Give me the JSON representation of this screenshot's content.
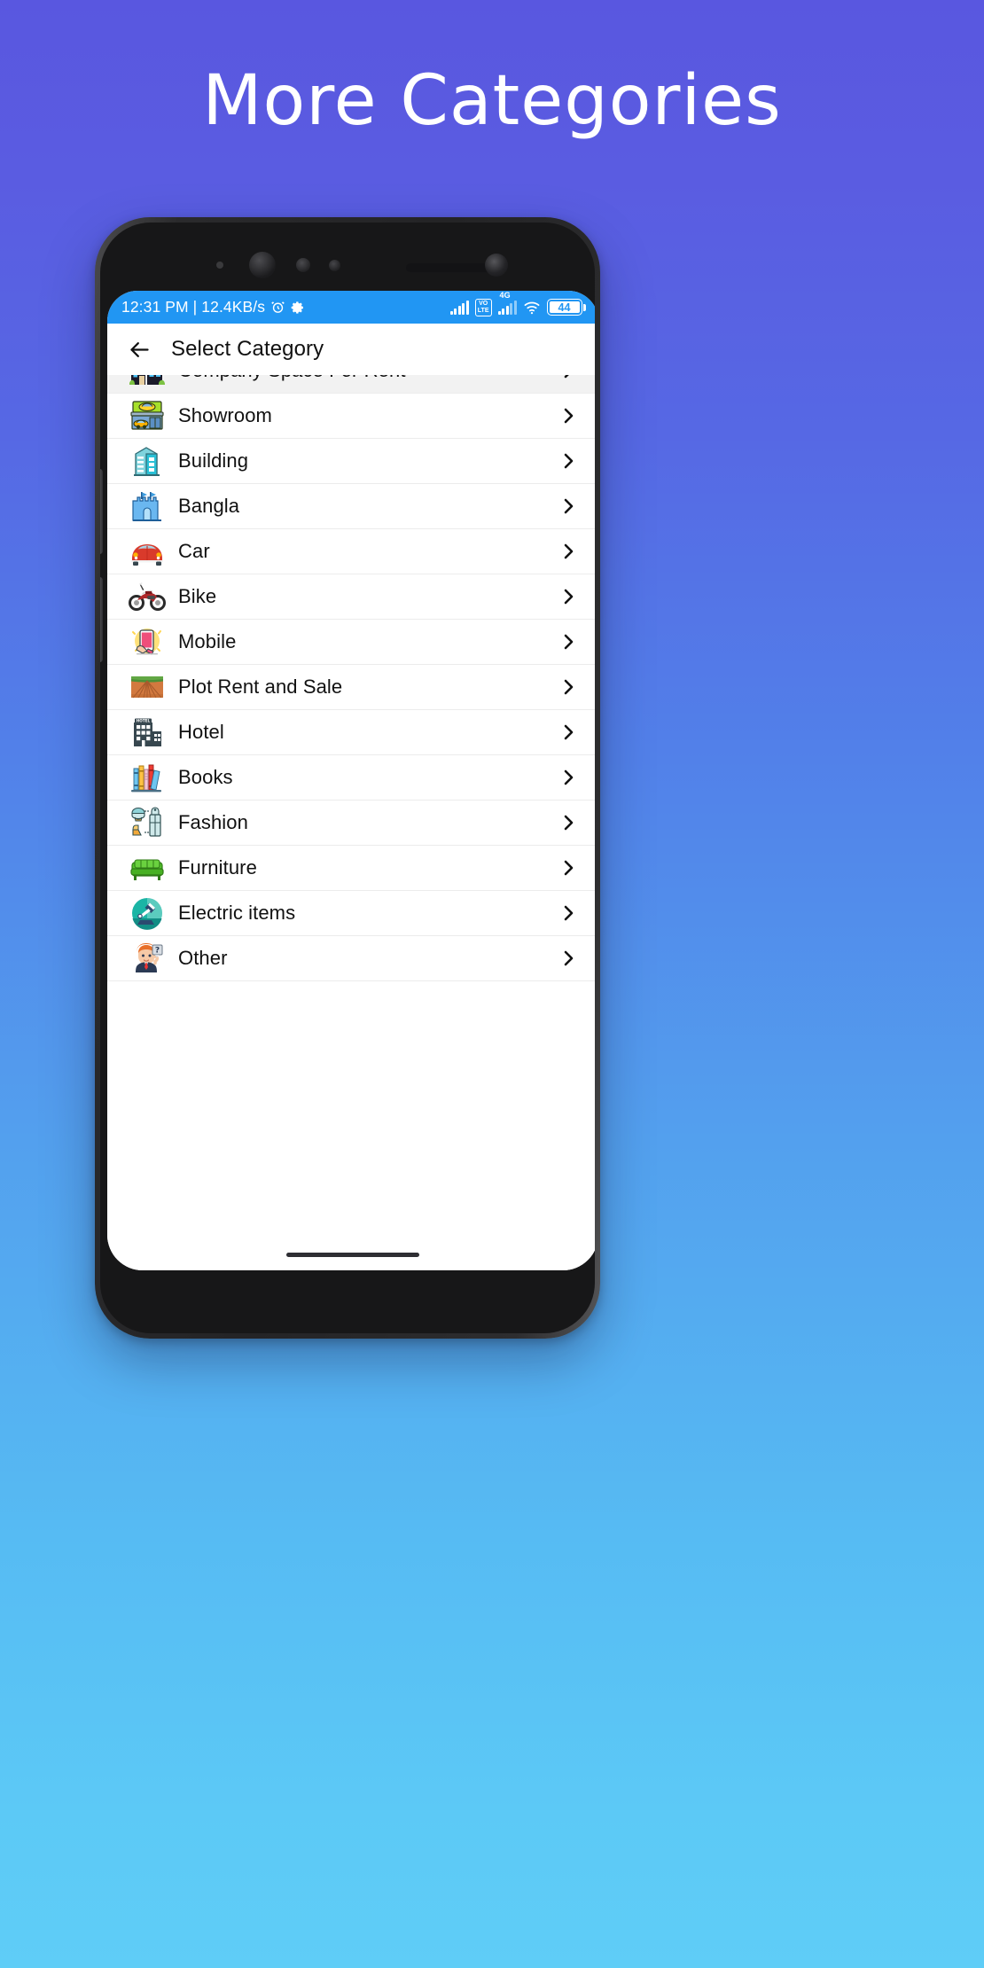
{
  "page": {
    "title": "More Categories",
    "background_top_color": "#5957e0",
    "background_bottom_color": "#5fcdf7"
  },
  "statusbar": {
    "time_and_speed": "12:31 PM | 12.4KB/s",
    "alarm_icon": "alarm-clock-icon",
    "settings_icon": "gear-icon",
    "signal_icon": "signal-bars-icon",
    "volte_label": "VO\nLTE",
    "volte_line1": "VO",
    "volte_line2": "LTE",
    "network_label": "4G",
    "wifi_icon": "wifi-icon",
    "battery_level": "44",
    "background_color": "#2196f3"
  },
  "appbar": {
    "back_icon": "back-arrow-icon",
    "title": "Select Category"
  },
  "list": {
    "chevron_icon": "chevron-right-icon",
    "items": [
      {
        "label": "Company Space For Rent",
        "icon": "office-buildings-icon",
        "partial": true
      },
      {
        "label": "Showroom",
        "icon": "car-showroom-icon",
        "partial": false
      },
      {
        "label": "Building",
        "icon": "building-icon",
        "partial": false
      },
      {
        "label": "Bangla",
        "icon": "castle-icon",
        "partial": false
      },
      {
        "label": "Car",
        "icon": "car-icon",
        "partial": false
      },
      {
        "label": "Bike",
        "icon": "motorcycle-icon",
        "partial": false
      },
      {
        "label": "Mobile",
        "icon": "mobile-phone-in-hand-icon",
        "partial": false
      },
      {
        "label": "Plot Rent and Sale",
        "icon": "farm-field-icon",
        "partial": false
      },
      {
        "label": "Hotel",
        "icon": "hotel-icon",
        "partial": false
      },
      {
        "label": "Books",
        "icon": "books-icon",
        "partial": false
      },
      {
        "label": "Fashion",
        "icon": "clothing-icon",
        "partial": false
      },
      {
        "label": "Furniture",
        "icon": "sofa-icon",
        "partial": false
      },
      {
        "label": "Electric items",
        "icon": "desk-lamp-icon",
        "partial": false
      },
      {
        "label": "Other",
        "icon": "person-question-icon",
        "partial": false
      }
    ]
  }
}
